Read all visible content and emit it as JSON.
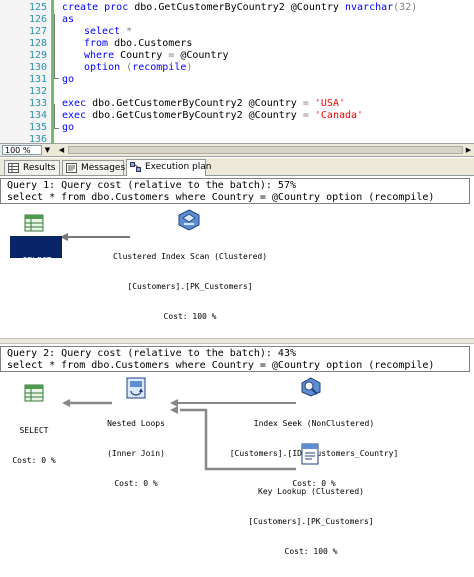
{
  "editor": {
    "lines": [
      {
        "num": "125"
      },
      {
        "num": "126"
      },
      {
        "num": "127"
      },
      {
        "num": "128"
      },
      {
        "num": "129"
      },
      {
        "num": "130"
      },
      {
        "num": "131"
      },
      {
        "num": "132"
      },
      {
        "num": "133"
      },
      {
        "num": "134"
      },
      {
        "num": "135"
      },
      {
        "num": "136"
      }
    ],
    "code": {
      "l125_kw": "create proc",
      "l125_name": " dbo.GetCustomerByCountry2 @Country ",
      "l125_type": "nvarchar",
      "l125_args": "(32)",
      "l126_kw": "as",
      "l127_kw": "select",
      "l127_rest": " *",
      "l128_kw": "from",
      "l128_rest": " dbo.Customers",
      "l129_kw": "where",
      "l129_rest": " Country ",
      "l129_op": "=",
      "l129_var": " @Country",
      "l130_kw": "option",
      "l130_p1": " (",
      "l130_opt": "recompile",
      "l130_p2": ")",
      "l131_kw": "go",
      "l133_kw": "exec",
      "l133_rest": " dbo.GetCustomerByCountry2 @Country ",
      "l133_op": "=",
      "l133_str": " 'USA'",
      "l134_kw": "exec",
      "l134_rest": " dbo.GetCustomerByCountry2 @Country ",
      "l134_op": "=",
      "l134_str": " 'Canada'",
      "l135_kw": "go"
    }
  },
  "zoom": {
    "value": "100 %"
  },
  "tabs": [
    {
      "label": "Results",
      "icon": "grid-icon"
    },
    {
      "label": "Messages",
      "icon": "messages-icon"
    },
    {
      "label": "Execution plan",
      "icon": "execution-plan-icon",
      "active": true
    }
  ],
  "plans": [
    {
      "header_line1": "Query 1: Query cost (relative to the batch): 57%",
      "header_line2": "select * from dbo.Customers where Country = @Country option (recompile)",
      "nodes": {
        "select": {
          "l1": "SELECT",
          "l2": "Cost: 0 %",
          "icon": "select-icon"
        },
        "scan": {
          "l1": "Clustered Index Scan (Clustered)",
          "l2": "[Customers].[PK_Customers]",
          "l3": "Cost: 100 %",
          "icon": "clustered-index-scan-icon"
        }
      }
    },
    {
      "header_line1": "Query 2: Query cost (relative to the batch): 43%",
      "header_line2": "select * from dbo.Customers where Country = @Country option (recompile)",
      "nodes": {
        "select": {
          "l1": "SELECT",
          "l2": "Cost: 0 %",
          "icon": "select-icon"
        },
        "loops": {
          "l1": "Nested Loops",
          "l2": "(Inner Join)",
          "l3": "Cost: 0 %",
          "icon": "nested-loops-icon"
        },
        "seek": {
          "l1": "Index Seek (NonClustered)",
          "l2": "[Customers].[IDX_Customers_Country]",
          "l3": "Cost: 0 %",
          "icon": "index-seek-icon"
        },
        "lookup": {
          "l1": "Key Lookup (Clustered)",
          "l2": "[Customers].[PK_Customers]",
          "l3": "Cost: 100 %",
          "icon": "key-lookup-icon"
        }
      }
    }
  ],
  "colors": {
    "keyword": "#0000ff",
    "string": "#ff0000",
    "operator": "#808080",
    "system_option": "#ff00ff",
    "line_number": "#2b91af",
    "selection": "#0a246a"
  }
}
